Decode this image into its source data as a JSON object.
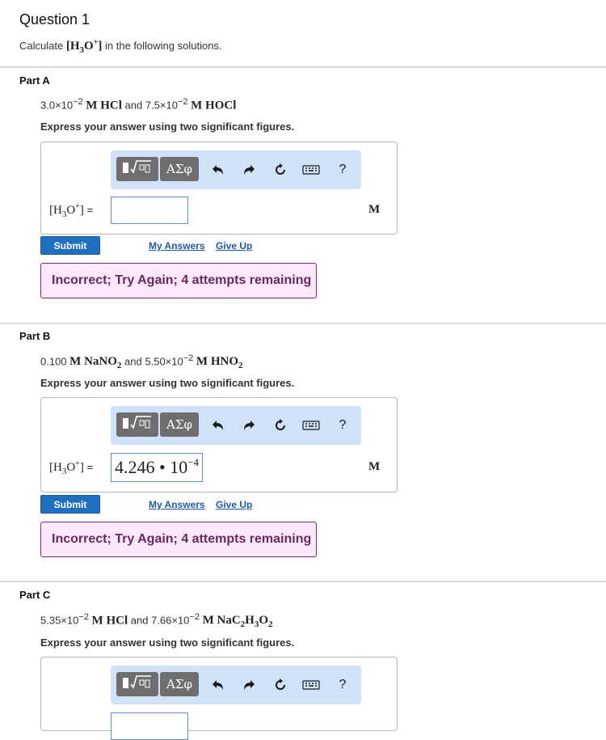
{
  "question": {
    "title": "Question 1",
    "instr_before": "Calculate",
    "instr_species": "[H3O+]",
    "instr_after": "in the following solutions."
  },
  "toolbar": {
    "templates_icon": "fraction-sqrt-template-icon",
    "greek_label": "ΑΣφ",
    "help_label": "?"
  },
  "common": {
    "express": "Express your answer using two significant figures.",
    "lhs": "[H3O+]",
    "eq": "=",
    "unit": "M",
    "submit": "Submit",
    "my_answers": "My Answers",
    "give_up": "Give Up",
    "feedback": "Incorrect; Try Again; 4 attempts remaining"
  },
  "parts": [
    {
      "title": "Part A",
      "c1": "3.0×10",
      "e1": "−2",
      "s1": "M HCl",
      "and": "and",
      "c2": "7.5×10",
      "e2": "−2",
      "s2": "M HOCl",
      "answer_value": "",
      "answer_exp": ""
    },
    {
      "title": "Part B",
      "c1": "0.100",
      "e1": "",
      "s1": "M NaNO2",
      "and": "and",
      "c2": "5.50×10",
      "e2": "−2",
      "s2": "M HNO2",
      "answer_value": "4.246 • 10",
      "answer_exp": "−4"
    },
    {
      "title": "Part C",
      "c1": "5.35×10",
      "e1": "−2",
      "s1": "M HCl",
      "and": "and",
      "c2": "7.66×10",
      "e2": "−2",
      "s2": "M NaC2H3O2",
      "answer_value": "",
      "answer_exp": ""
    }
  ],
  "colors": {
    "submit": "#1f6fbf",
    "feedback_bg": "#fde9fb",
    "feedback_border": "#7d2c73",
    "toolbar_bg": "#cfe2f7",
    "link": "#2059a5"
  }
}
